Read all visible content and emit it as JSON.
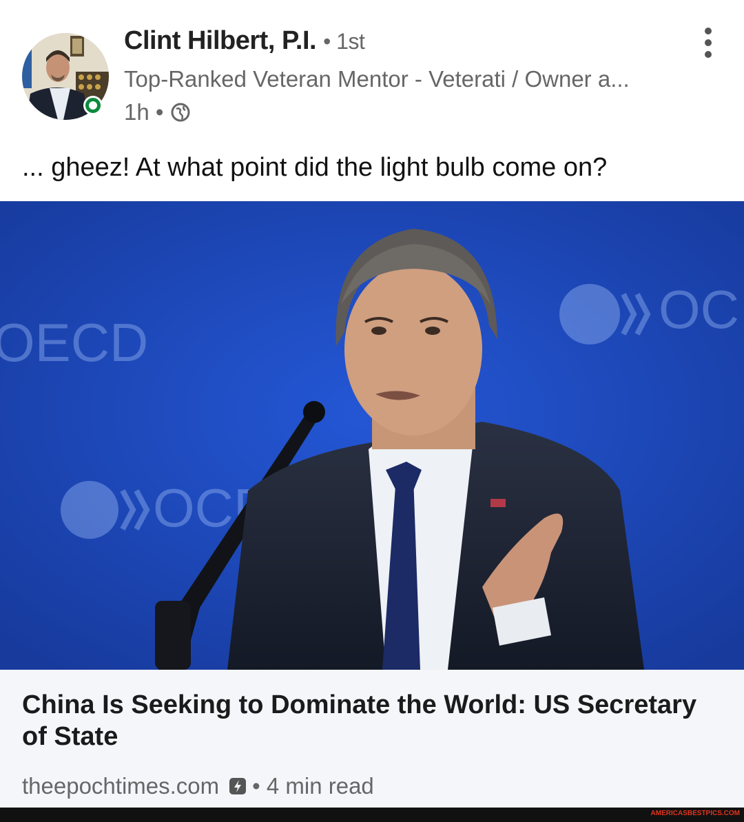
{
  "post": {
    "author_name": "Clint Hilbert, P.I.",
    "connection_degree": "• 1st",
    "headline": "Top-Ranked Veteran Mentor - Veterati / Owner a...",
    "time": "1h •",
    "visibility_icon": "globe-icon",
    "text": "... gheez!  At what point did the light bulb come on?"
  },
  "article": {
    "image_text_left": "OECD",
    "image_text_mid": "OCD",
    "image_text_right": "OC",
    "title": "China Is Seeking to Dominate the World: US Secretary of State",
    "source": "theepochtimes.com",
    "amp_icon": "lightning-icon",
    "read_time": "• 4 min read"
  },
  "footer": {
    "watermark": "AMERICASBESTPICS.COM"
  },
  "colors": {
    "online": "#0b8a3c",
    "backdrop_blue": "#1d4cc2",
    "watermark": "#e0341e"
  }
}
